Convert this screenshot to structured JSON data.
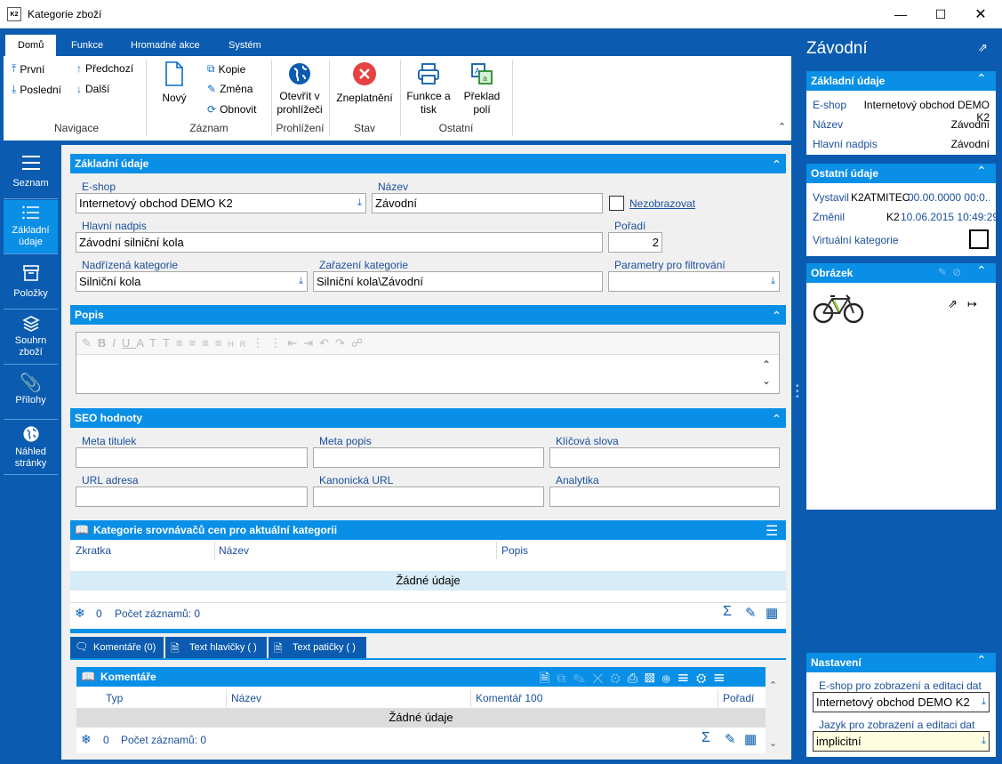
{
  "window": {
    "title": "Kategorie zboží",
    "app_icon": "K2"
  },
  "ribbon": {
    "tabs": [
      "Domů",
      "Funkce",
      "Hromadné akce",
      "Systém"
    ],
    "nav": {
      "first": "První",
      "last": "Poslední",
      "prev": "Předchozí",
      "next": "Další",
      "group": "Navigace"
    },
    "record": {
      "new": "Nový",
      "copy": "Kopie",
      "change": "Změna",
      "refresh": "Obnovit",
      "group": "Záznam"
    },
    "browse": {
      "open": "Otevřít v prohlížeči",
      "group": "Prohlížení"
    },
    "state": {
      "invalidate": "Zneplatnění",
      "group": "Stav"
    },
    "other": {
      "print": "Funkce a tisk",
      "translate": "Překlad polí",
      "group": "Ostatní"
    }
  },
  "leftnav": [
    {
      "label": "Seznam",
      "icon": "list-lines-icon"
    },
    {
      "label": "Základní údaje",
      "icon": "list-icon"
    },
    {
      "label": "Položky",
      "icon": "box-icon"
    },
    {
      "label": "Souhrn zboží",
      "icon": "layers-icon"
    },
    {
      "label": "Přílohy",
      "icon": "paperclip-icon"
    },
    {
      "label": "Náhled stránky",
      "icon": "globe-icon"
    }
  ],
  "basic": {
    "title": "Základní údaje",
    "eshop_label": "E-shop",
    "eshop_value": "Internetový obchod DEMO K2",
    "name_label": "Název",
    "name_value": "Závodní",
    "hidden_label": "Nezobrazovat",
    "heading_label": "Hlavní nadpis",
    "heading_value": "Závodní silniční kola",
    "order_label": "Pořadí",
    "order_value": "2",
    "parent_label": "Nadřízená kategorie",
    "parent_value": "Silniční kola",
    "placement_label": "Zařazení kategorie",
    "placement_value": "Silniční kola\\Závodní",
    "filter_label": "Parametry pro filtrování",
    "filter_value": ""
  },
  "popis": {
    "title": "Popis"
  },
  "seo": {
    "title": "SEO hodnoty",
    "meta_title": "Meta titulek",
    "meta_desc": "Meta popis",
    "keywords": "Klíčová slova",
    "url": "URL adresa",
    "canonical": "Kanonická URL",
    "analytics": "Analytika"
  },
  "comparators": {
    "title": "Kategorie srovnávačů cen pro aktuální kategorii",
    "columns": [
      "Zkratka",
      "Název",
      "Popis"
    ],
    "empty": "Žádné údaje",
    "count": "0",
    "count_label": "Počet záznamů: 0"
  },
  "bottomtabs": [
    "Komentáře (0)",
    "Text hlavičky ( )",
    "Text patičky ( )"
  ],
  "comments": {
    "title": "Komentáře",
    "columns": [
      "Typ",
      "Název",
      "Komentář 100",
      "Pořadí"
    ],
    "empty": "Žádné údaje",
    "count": "0",
    "count_label": "Počet záznamů: 0"
  },
  "right": {
    "title": "Závodní",
    "basic": {
      "title": "Základní údaje",
      "rows": [
        [
          "E-shop",
          "Internetový obchod DEMO K2"
        ],
        [
          "Název",
          "Závodní"
        ],
        [
          "Hlavní nadpis",
          "Závodní"
        ]
      ]
    },
    "other": {
      "title": "Ostatní údaje",
      "created_label": "Vystavil",
      "created_user": "K2ATMITEC",
      "created_date": "00.00.0000 00:0...",
      "changed_label": "Změnil",
      "changed_user": "K2",
      "changed_date": "10.06.2015 10:49:29",
      "virtual_label": "Virtuální kategorie"
    },
    "image": {
      "title": "Obrázek"
    },
    "settings": {
      "title": "Nastavení",
      "eshop_label": "E-shop pro zobrazení a editaci dat",
      "eshop_value": "Internetový obchod DEMO K2",
      "lang_label": "Jazyk pro zobrazení a editaci dat",
      "lang_value": "implicitní"
    }
  }
}
